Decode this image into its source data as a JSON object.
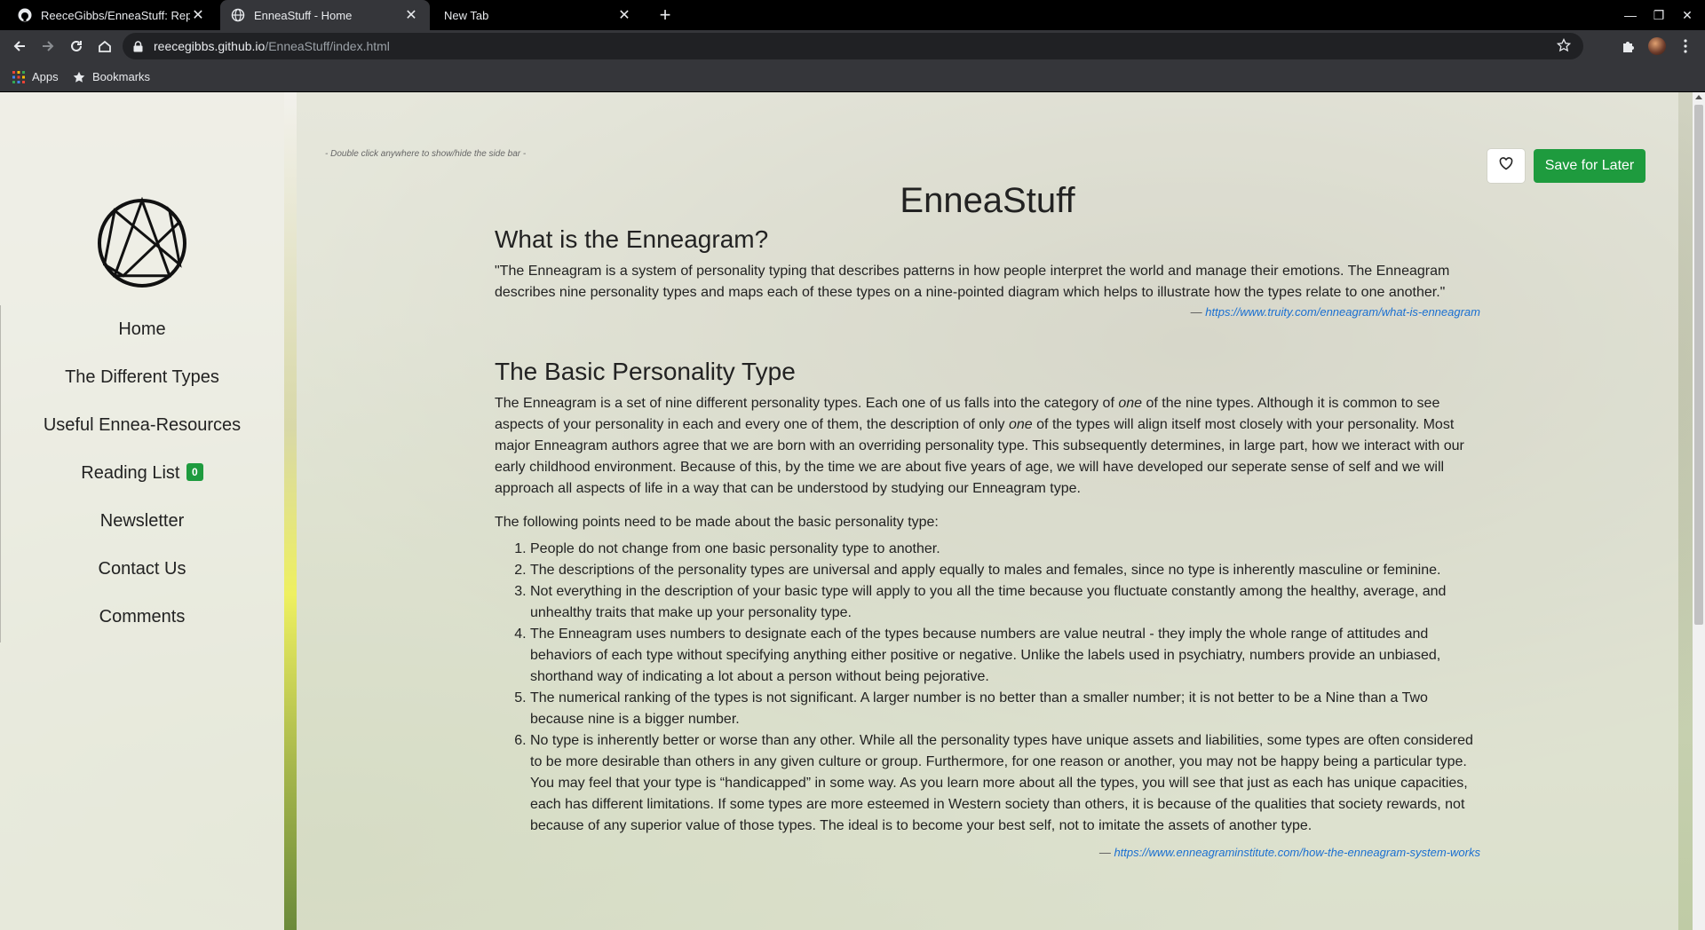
{
  "browser": {
    "tabs": [
      {
        "title": "ReeceGibbs/EnneaStuff: Repo",
        "icon": "github-icon"
      },
      {
        "title": "EnneaStuff - Home",
        "icon": "globe-icon"
      },
      {
        "title": "New Tab",
        "icon": ""
      }
    ],
    "url_host": "reecegibbs.github.io",
    "url_path": "/EnneaStuff/index.html",
    "bookmarks": {
      "apps": "Apps",
      "bookmarks": "Bookmarks"
    }
  },
  "sidebar": {
    "logo": "enneagram-logo",
    "items": [
      {
        "label": "Home"
      },
      {
        "label": "The Different Types"
      },
      {
        "label": "Useful Ennea-Resources"
      },
      {
        "label": "Reading List",
        "badge": "0"
      },
      {
        "label": "Newsletter"
      },
      {
        "label": "Contact Us"
      },
      {
        "label": "Comments"
      }
    ]
  },
  "main": {
    "hint": "- Double click anywhere to show/hide the side bar -",
    "save_label": "Save for Later",
    "title": "EnneaStuff",
    "section1": {
      "heading": "What is the Enneagram?",
      "quote": "\"The Enneagram is a system of personality typing that describes patterns in how people interpret the world and manage their emotions. The Enneagram describes nine personality types and maps each of these types on a nine-pointed diagram which helps to illustrate how the types relate to one another.\"",
      "cite_dash": "—",
      "cite_url": "https://www.truity.com/enneagram/what-is-enneagram"
    },
    "section2": {
      "heading": "The Basic Personality Type",
      "p1_a": "The Enneagram is a set of nine different personality types. Each one of us falls into the category of ",
      "p1_em1": "one",
      "p1_b": " of the nine types. Although it is common to see aspects of your personality in each and every one of them, the description of only ",
      "p1_em2": "one",
      "p1_c": " of the types will align itself most closely with your personality. Most major Enneagram authors agree that we are born with an overriding personality type. This subsequently determines, in large part, how we interact with our early childhood environment. Because of this, by the time we are about five years of age, we will have developed our seperate sense of self and we will approach all aspects of life in a way that can be understood by studying our Enneagram type.",
      "intro": "The following points need to be made about the basic personality type:",
      "points": [
        "People do not change from one basic personality type to another.",
        "The descriptions of the personality types are universal and apply equally to males and females, since no type is inherently masculine or feminine.",
        "Not everything in the description of your basic type will apply to you all the time because you fluctuate constantly among the healthy, average, and unhealthy traits that make up your personality type.",
        "The Enneagram uses numbers to designate each of the types because numbers are value neutral - they imply the whole range of attitudes and behaviors of each type without specifying anything either positive or negative. Unlike the labels used in psychiatry, numbers provide an unbiased, shorthand way of indicating a lot about a person without being pejorative.",
        "The numerical ranking of the types is not significant. A larger number is no better than a smaller number; it is not better to be a Nine than a Two because nine is a bigger number.",
        "No type is inherently better or worse than any other. While all the personality types have unique assets and liabilities, some types are often considered to be more desirable than others in any given culture or group. Furthermore, for one reason or another, you may not be happy being a particular type. You may feel that your type is “handicapped” in some way. As you learn more about all the types, you will see that just as each has unique capacities, each has different limitations. If some types are more esteemed in Western society than others, it is because of the qualities that society rewards, not because of any superior value of those types. The ideal is to become your best self, not to imitate the assets of another type."
      ],
      "cite_dash": "—",
      "cite_url": "https://www.enneagraminstitute.com/how-the-enneagram-system-works"
    }
  },
  "colors": {
    "accent_green": "#1e9b3e",
    "link_blue": "#1a6fd1"
  }
}
